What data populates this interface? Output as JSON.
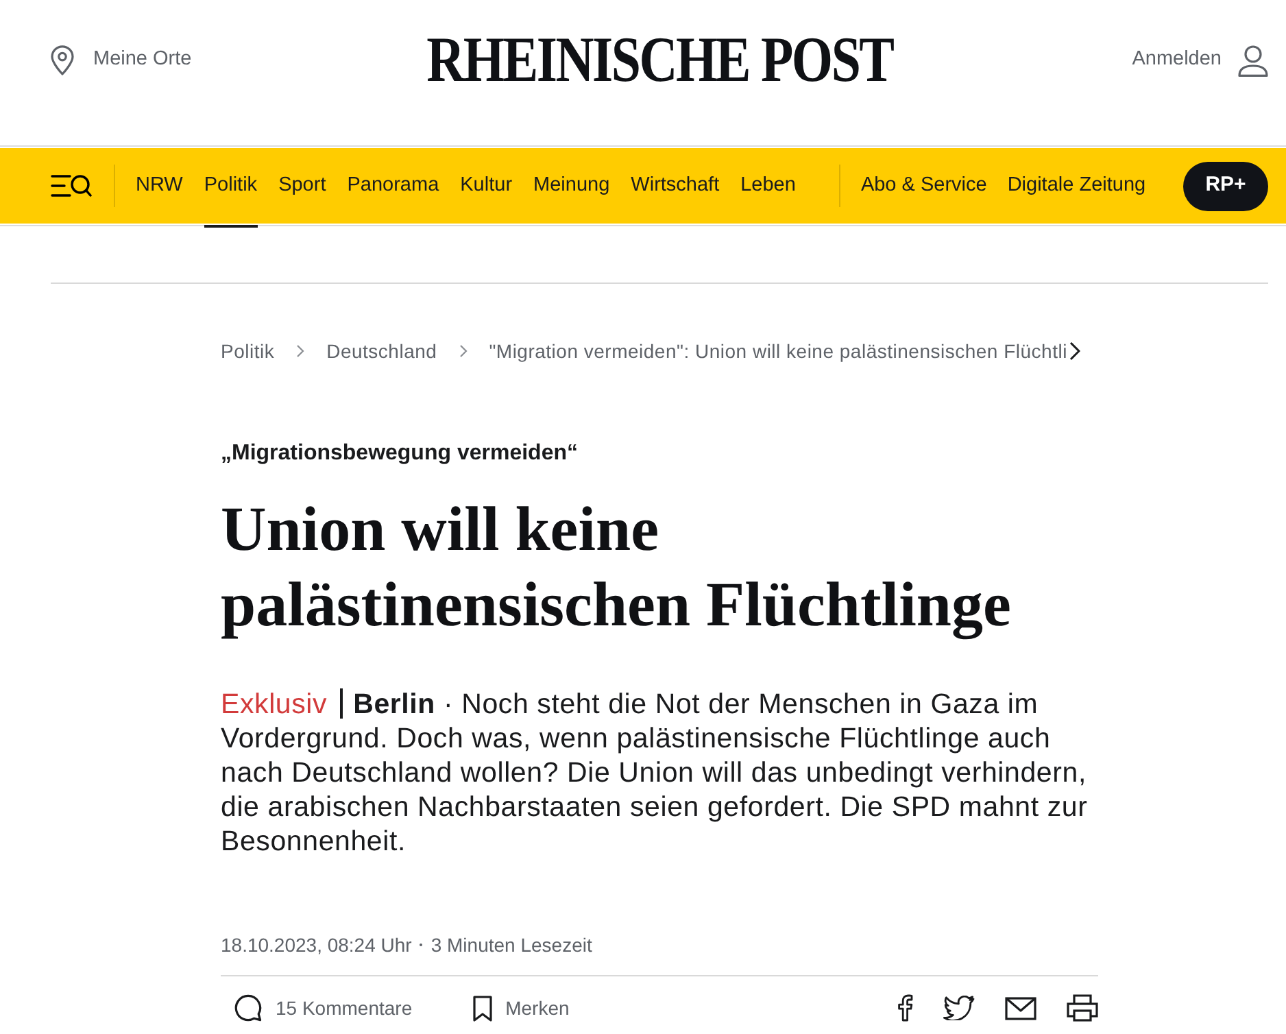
{
  "header": {
    "location_link": "Meine Orte",
    "logo": "RHEINISCHE POST",
    "login_link": "Anmelden"
  },
  "nav": {
    "sections": [
      {
        "label": "NRW",
        "selected": false
      },
      {
        "label": "Politik",
        "selected": true
      },
      {
        "label": "Sport",
        "selected": false
      },
      {
        "label": "Panorama",
        "selected": false
      },
      {
        "label": "Kultur",
        "selected": false
      },
      {
        "label": "Meinung",
        "selected": false
      },
      {
        "label": "Wirtschaft",
        "selected": false
      },
      {
        "label": "Leben",
        "selected": false
      }
    ],
    "services": [
      {
        "label": "Abo & Service",
        "selected": false
      },
      {
        "label": "Digitale Zeitung",
        "selected": false
      }
    ],
    "plus_button": "RP+"
  },
  "breadcrumb": [
    "Politik",
    "Deutschland",
    "\"Migration vermeiden\": Union will keine palästinensischen Flüchtli"
  ],
  "article": {
    "kicker": "„Migrationsbewegung vermeiden“",
    "headline": "Union will keine palästinensischen Flüchtlinge",
    "teaser": {
      "label": "Exklusiv",
      "text": "**Berlin** · Noch steht die Not der Menschen in Gaza im Vordergrund. Doch was, wenn palästinensische Flüchtlinge auch nach Deutschland wollen? Die Union will das unbedingt verhindern, die arabischen Nachbarstaaten seien gefordert. Die SPD mahnt zur Besonnenheit."
    },
    "date": "18.10.2023, 08:24 Uhr",
    "reading_time": "3 Minuten Lesezeit",
    "actions": [
      {
        "kind": "comments",
        "label": "15 Kommentare"
      },
      {
        "kind": "bookmark",
        "label": "Merken"
      }
    ],
    "share": [
      {
        "kind": "facebook"
      },
      {
        "kind": "twitter"
      },
      {
        "kind": "email"
      },
      {
        "kind": "print"
      }
    ]
  }
}
